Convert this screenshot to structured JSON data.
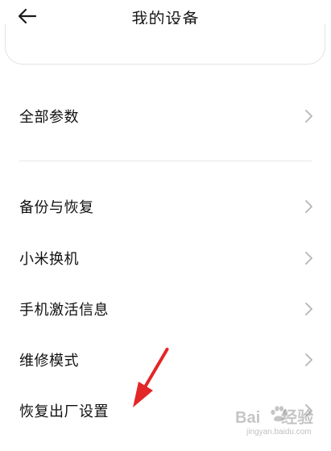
{
  "header": {
    "title": "我的设备",
    "back_icon": "arrow-left-icon"
  },
  "rows": [
    {
      "label": "全部参数"
    },
    {
      "label": "备份与恢复"
    },
    {
      "label": "小米换机"
    },
    {
      "label": "手机激活信息"
    },
    {
      "label": "维修模式"
    },
    {
      "label": "恢复出厂设置"
    }
  ],
  "chevron_icon": "chevron-right-icon",
  "colors": {
    "text": "#111111",
    "chevron": "#b5b5b5",
    "divider": "#e6e6e6",
    "annotation_arrow": "#e32626"
  },
  "watermark": {
    "text_left": "Bai",
    "text_right": "经验",
    "subtext": "jingyan.baidu.com"
  }
}
